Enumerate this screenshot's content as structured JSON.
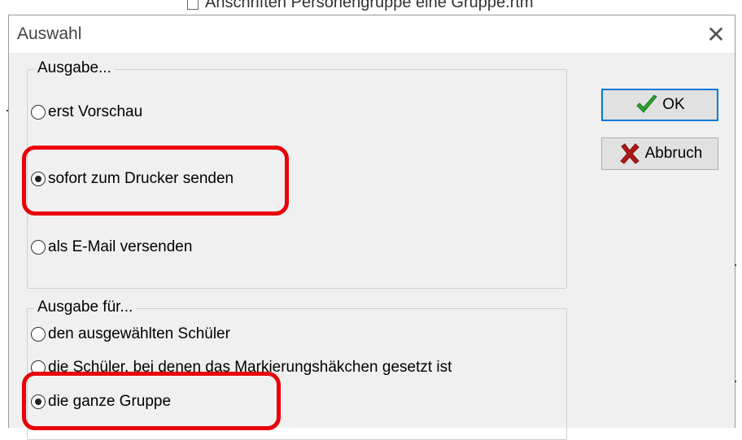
{
  "background_window": {
    "title": "Anschriften Personengruppe eine Gruppe.rtm"
  },
  "dialog": {
    "title": "Auswahl",
    "close_glyph": "✕",
    "group_output": {
      "legend": "Ausgabe...",
      "options": [
        {
          "label": "erst Vorschau",
          "selected": false
        },
        {
          "label": "sofort zum Drucker senden",
          "selected": true
        },
        {
          "label": "als E-Mail versenden",
          "selected": false
        }
      ]
    },
    "group_target": {
      "legend": "Ausgabe für...",
      "options": [
        {
          "label": "den ausgewählten Schüler",
          "selected": false
        },
        {
          "label": "die Schüler, bei denen das Markierungshäkchen gesetzt ist",
          "selected": false
        },
        {
          "label": "die ganze Gruppe",
          "selected": true
        }
      ]
    },
    "buttons": {
      "ok_label": "OK",
      "ok_icon": "checkmark-icon",
      "cancel_label": "Abbruch",
      "cancel_icon": "x-icon"
    }
  },
  "colors": {
    "highlight": "#e8000a",
    "ok_check": "#2e9e2e",
    "cancel_x": "#b01818",
    "default_button_border": "#0078d7"
  }
}
